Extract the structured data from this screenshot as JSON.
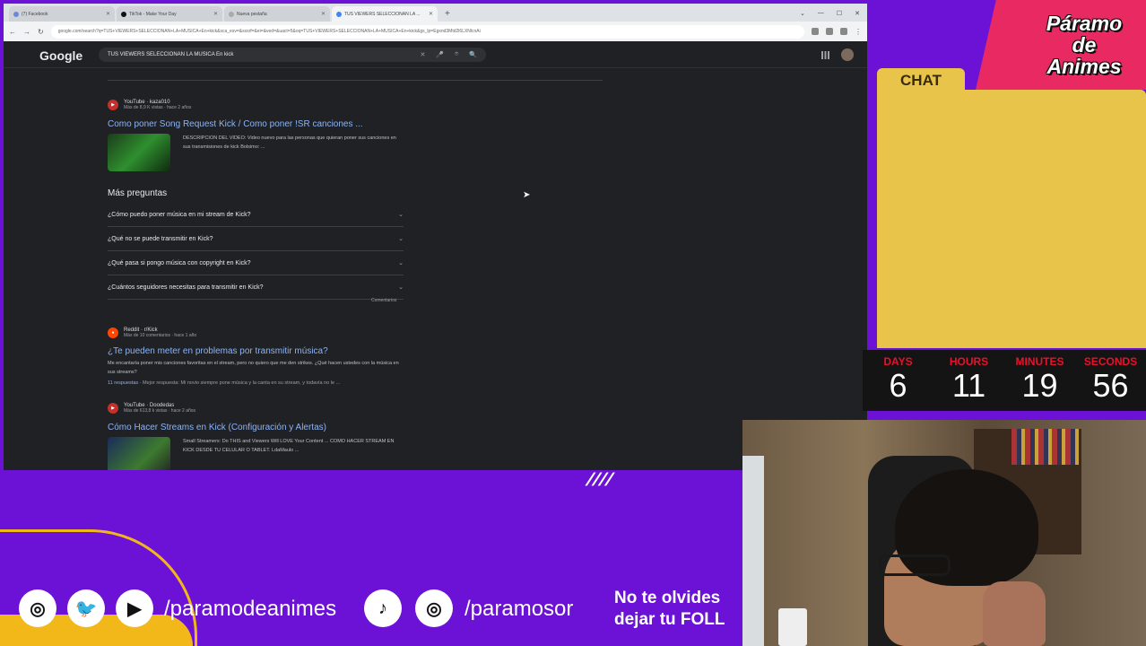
{
  "browser": {
    "tabs": [
      {
        "label": "(7) Facebook",
        "active": false
      },
      {
        "label": "TikTok - Make Your Day",
        "active": false
      },
      {
        "label": "Nueva pestaña",
        "active": false
      },
      {
        "label": "TUS VIEWERS SELECCIONAN LA ...",
        "active": true
      }
    ],
    "new_tab": "+",
    "window_controls": [
      "⌄",
      "—",
      "☐",
      "✕"
    ],
    "url": "google.com/search?q=TUS+VIEWERS+SELECCIONAN+LA+MUSICA+En+kick&sca_esv=&sxsrf=&ei=&ved=&uact=5&oq=TUS+VIEWERS+SELECCIONAN+LA+MUSICA+En+kick&gs_lp=Egxnd3Mtd2l6LXNlcnAi",
    "nav": {
      "back": "←",
      "forward": "→",
      "reload": "↻"
    }
  },
  "google": {
    "logo": "Google",
    "query": "TUS VIEWERS SELECCIONAN LA MUSICA En kick",
    "search_icons": {
      "clear": "✕",
      "mic": "🎤",
      "lens": "⌾",
      "search": "🔍"
    }
  },
  "results": [
    {
      "source": "YouTube · kaza010",
      "meta": "Más de 8,9 K vistas · hace 2 años",
      "title": "Como poner Song Request Kick / Como poner !SR canciones ...",
      "snippet": "DESCRIPCION DEL VIDEO: Video nuevo para las personas que quieran poner sus canciones en sus transmisiones de kick Bolsimo: ..."
    }
  ],
  "paa": {
    "title": "Más preguntas",
    "questions": [
      "¿Cómo puedo poner música en mi stream de Kick?",
      "¿Qué no se puede transmitir en Kick?",
      "¿Qué pasa si pongo música con copyright en Kick?",
      "¿Cuántos seguidores necesitas para transmitir en Kick?"
    ],
    "feedback": "Comentarios"
  },
  "reddit": {
    "source": "Reddit · r/Kick",
    "meta": "Más de 10 comentarios · hace 1 año",
    "title": "¿Te pueden meter en problemas por transmitir música?",
    "snippet": "Me encantaría poner mis canciones favoritas en el stream, pero no quiero que me den strikes. ¿Qué hacen ustedes con la música en sus streams?",
    "answers": "11 respuestas",
    "answers_extra": " · Mejor respuesta: Mi novio siempre pone música y la canta en su stream, y todavía no le ..."
  },
  "youtube2": {
    "source": "YouTube · Doodedas",
    "meta": "Más de 613,8 k vistas · hace 2 años",
    "title": "Cómo Hacer Streams en Kick (Configuración y Alertas)",
    "snippet": "Small Streamers: Do THIS and Viewers Will LOVE Your Content ... COMO HACER STREAM EN KICK DESDE TU CELULAR O TABLET. LdaMaulo ..."
  },
  "overlay": {
    "brand": [
      "Páramo",
      "de",
      "Animes"
    ],
    "chat_label": "CHAT",
    "countdown": [
      {
        "label": "DAYS",
        "value": "6"
      },
      {
        "label": "HOURS",
        "value": "11"
      },
      {
        "label": "MINUTES",
        "value": "19"
      },
      {
        "label": "SECONDS",
        "value": "56"
      }
    ],
    "handle_1": "/paramodeanimes",
    "handle_2": "/paramosor",
    "reminder_line1": "No te olvides",
    "reminder_line2": "dejar tu FOLL",
    "colors": {
      "purple": "#6b12d6",
      "pink": "#e92a62",
      "yellow": "#e8c54a",
      "red": "#e8122a"
    }
  }
}
